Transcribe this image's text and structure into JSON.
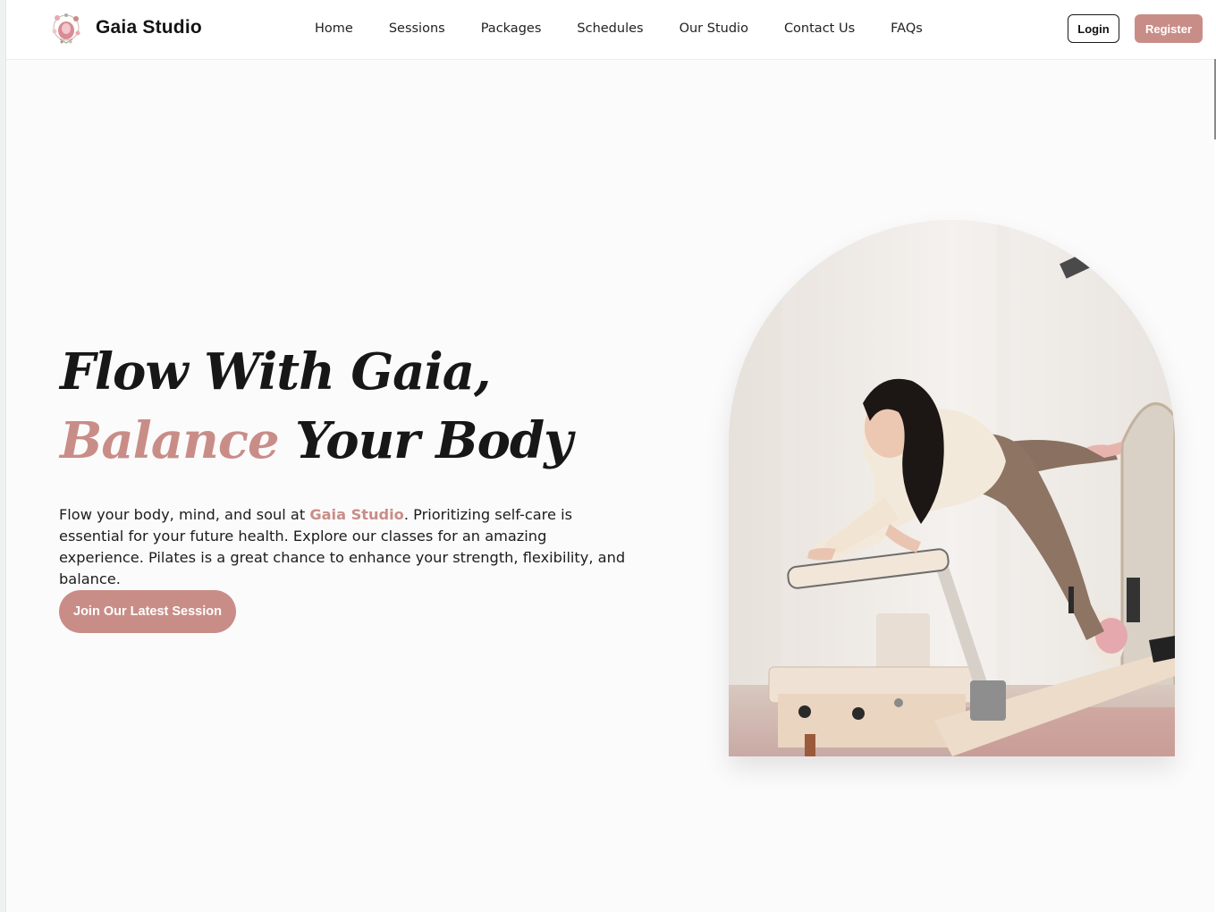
{
  "brand": {
    "name": "Gaia Studio",
    "logo_icon": "flower-wreath-logo-icon",
    "accent_color": "#c98d88"
  },
  "nav": {
    "links": [
      "Home",
      "Sessions",
      "Packages",
      "Schedules",
      "Our Studio",
      "Contact Us",
      "FAQs"
    ],
    "login_label": "Login",
    "register_label": "Register"
  },
  "hero": {
    "title_line1": "Flow With Gaia,",
    "title_accent": "Balance",
    "title_rest": " Your Body",
    "desc_before": "Flow your body, mind, and soul at ",
    "desc_brand": "Gaia Studio",
    "desc_after": ". Prioritizing self-care is essential for your future health. Explore our classes for an amazing experience. Pilates is a great chance to enhance your strength, flexibility, and balance.",
    "cta_label": "Join Our Latest Session",
    "image_icon": "pilates-reformer-photo"
  }
}
